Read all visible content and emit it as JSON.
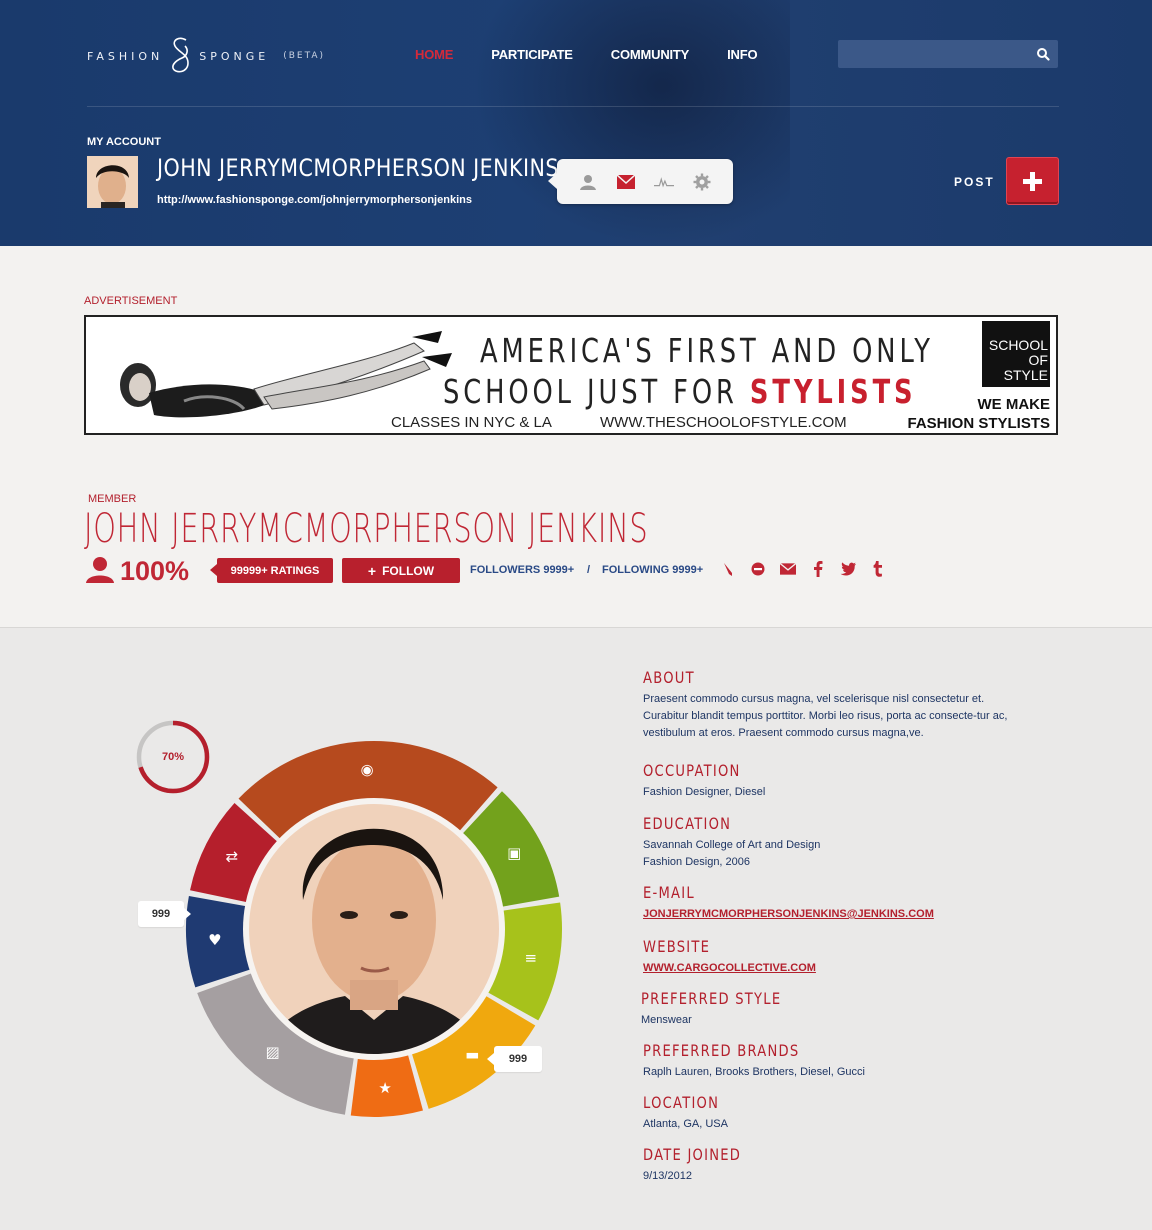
{
  "header": {
    "logo_left": "FASHION",
    "logo_right": "SPONGE",
    "logo_beta": "(BETA)",
    "nav": [
      {
        "label": "HOME",
        "active": true
      },
      {
        "label": "PARTICIPATE",
        "active": false
      },
      {
        "label": "COMMUNITY",
        "active": false
      },
      {
        "label": "INFO",
        "active": false
      }
    ],
    "search_placeholder": "",
    "my_account_label": "MY ACCOUNT",
    "account_name": "JOHN JERRYMCMORPHERSON JENKINS",
    "account_url": "http://www.fashionsponge.com/johnjerrymorphersonjenkins",
    "popover_icons": [
      "profile-icon",
      "mail-icon",
      "activity-icon",
      "settings-icon"
    ],
    "post_label": "POST"
  },
  "ad": {
    "label": "ADVERTISEMENT",
    "line1": "AMERICA'S FIRST AND ONLY",
    "line2_prefix": "SCHOOL JUST FOR",
    "line2_highlight": "STYLISTS",
    "classes": "CLASSES IN NYC & LA",
    "website": "WWW.THESCHOOLOFSTYLE.COM",
    "school_line1": "SCHOOL",
    "school_line2": "OF STYLE",
    "tagline1": "WE MAKE",
    "tagline2": "FASHION STYLISTS"
  },
  "member": {
    "label": "MEMBER",
    "name": "JOHN JERRYMCMORPHERSON JENKINS",
    "percent": "100%",
    "ratings": "99999+ RATINGS",
    "follow_label": "FOLLOW",
    "followers": "FOLLOWERS 9999+",
    "separator": "/",
    "following": "FOLLOWING 9999+",
    "action_icons": [
      "pencil-icon",
      "block-icon",
      "mail-icon",
      "facebook-icon",
      "twitter-icon",
      "tumblr-icon"
    ]
  },
  "profile": {
    "completion": "70%",
    "completion_fraction": 0.7,
    "likes_count": "999",
    "comments_count": "999",
    "segments": [
      {
        "name": "views",
        "color": "#b64a1e",
        "icon": "eye-icon"
      },
      {
        "name": "profile",
        "color": "#73a21c",
        "icon": "contact-icon"
      },
      {
        "name": "articles",
        "color": "#a7c21b",
        "icon": "text-icon"
      },
      {
        "name": "comments",
        "color": "#f0a80e",
        "icon": "comment-icon"
      },
      {
        "name": "favorites",
        "color": "#ef6c14",
        "icon": "star-icon"
      },
      {
        "name": "photos",
        "color": "#a59fa1",
        "icon": "image-icon"
      },
      {
        "name": "likes",
        "color": "#1f3a72",
        "icon": "heart-icon"
      },
      {
        "name": "reposts",
        "color": "#b51f2c",
        "icon": "repost-icon"
      }
    ]
  },
  "about": {
    "about_title": "ABOUT",
    "about_text": "Praesent commodo cursus magna, vel scelerisque nisl consectetur et. Curabitur blandit tempus porttitor. Morbi leo risus, porta ac consecte-tur ac, vestibulum at eros. Praesent commodo cursus magna,ve.",
    "occupation_title": "OCCUPATION",
    "occupation": "Fashion Designer, Diesel",
    "education_title": "EDUCATION",
    "education_school": "Savannah College of Art and Design",
    "education_degree": "Fashion Design, 2006",
    "email_title": "E-MAIL",
    "email": "JONJERRYMCMORPHERSONJENKINS@JENKINS.COM",
    "website_title": "WEBSITE",
    "website": "WWW.CARGOCOLLECTIVE.COM",
    "style_title": "PREFERRED STYLE",
    "style": "Menswear",
    "brands_title": "PREFERRED BRANDS",
    "brands": "Raplh Lauren, Brooks Brothers, Diesel, Gucci",
    "location_title": "LOCATION",
    "location": "Atlanta, GA, USA",
    "joined_title": "DATE JOINED",
    "joined": "9/13/2012"
  }
}
